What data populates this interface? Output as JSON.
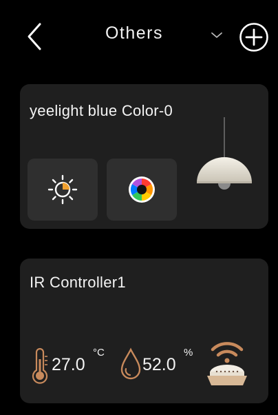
{
  "header": {
    "title": "Others",
    "back_icon": "chevron-left-icon",
    "dropdown_icon": "chevron-down-icon",
    "add_icon": "plus-circle-icon"
  },
  "devices": [
    {
      "name": "yeelight blue Color-0",
      "controls": [
        {
          "icon": "brightness-icon"
        },
        {
          "icon": "color-wheel-icon"
        }
      ],
      "image_icon": "pendant-lamp-icon"
    },
    {
      "name": "IR Controller1",
      "temperature": {
        "value": "27.0",
        "unit": "°C",
        "icon": "thermometer-icon"
      },
      "humidity": {
        "value": "52.0",
        "unit": "%",
        "icon": "water-drop-icon"
      },
      "image_icon": "ir-controller-icon"
    }
  ],
  "colors": {
    "background": "#000000",
    "card": "#1f1f1f",
    "button": "#2f2f2f",
    "accent_copper": "#c88a5c",
    "accent_orange": "#f0a030"
  }
}
